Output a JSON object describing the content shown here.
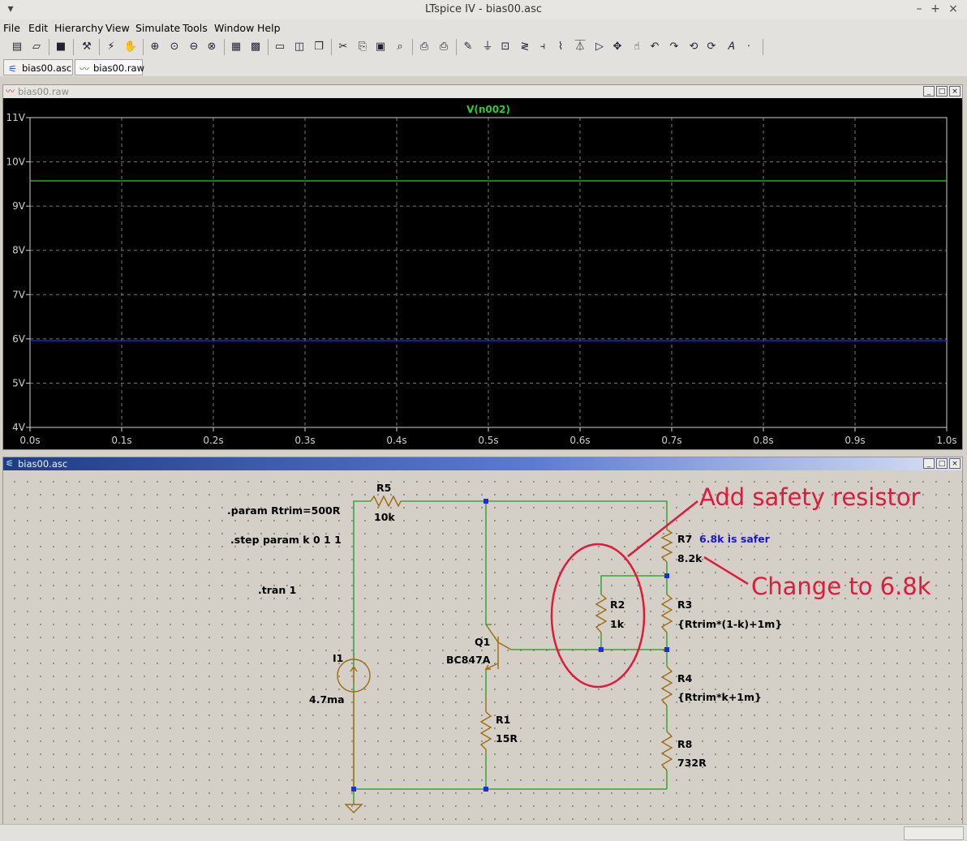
{
  "app": {
    "window_title": "LTspice IV - bias00.asc",
    "menu": [
      "File",
      "Edit",
      "Hierarchy",
      "View",
      "Simulate",
      "Tools",
      "Window",
      "Help"
    ],
    "tabs": [
      "bias00.asc",
      "bias00.raw"
    ]
  },
  "waveform_window": {
    "title": "bias00.raw",
    "trace_label": "V(n002)",
    "colors": {
      "background": "#000000",
      "trace_green": "#2ecc2e",
      "trace_blue": "#2233ee",
      "grid": "#7a7a7a",
      "axis_text": "#d0d0d0"
    }
  },
  "chart_data": {
    "type": "line",
    "title": "V(n002)",
    "xlabel": "",
    "ylabel": "",
    "xlim": [
      0.0,
      1.0
    ],
    "ylim": [
      4,
      11
    ],
    "x_ticks": [
      "0.0s",
      "0.1s",
      "0.2s",
      "0.3s",
      "0.4s",
      "0.5s",
      "0.6s",
      "0.7s",
      "0.8s",
      "0.9s",
      "1.0s"
    ],
    "y_ticks": [
      "11V",
      "10V",
      "9V",
      "8V",
      "7V",
      "6V",
      "5V",
      "4V"
    ],
    "grid": true,
    "series": [
      {
        "color": "#2ecc2e",
        "x": [
          0.0,
          1.0
        ],
        "y": [
          9.57,
          9.57
        ]
      },
      {
        "color": "#2233ee",
        "x": [
          0.0,
          1.0
        ],
        "y": [
          5.96,
          5.96
        ]
      }
    ]
  },
  "schematic_window": {
    "title": "bias00.asc",
    "directives": [
      ".param Rtrim=500R",
      ".step param k 0 1 1",
      ".tran 1"
    ],
    "components": {
      "R5": {
        "name": "R5",
        "value": "10k"
      },
      "R7": {
        "name": "R7",
        "value": "8.2k",
        "note": "6.8k is safer"
      },
      "R3": {
        "name": "R3",
        "value": "{Rtrim*(1-k)+1m}"
      },
      "R2": {
        "name": "R2",
        "value": "1k"
      },
      "Q1": {
        "name": "Q1",
        "value": "BC847A"
      },
      "I1": {
        "name": "I1",
        "value": "4.7ma"
      },
      "R4": {
        "name": "R4",
        "value": "{Rtrim*k+1m}"
      },
      "R1": {
        "name": "R1",
        "value": "15R"
      },
      "R8": {
        "name": "R8",
        "value": "732R"
      }
    },
    "annotations": {
      "add_resistor": "Add safety resistor",
      "change_value": "Change to 6.8k"
    },
    "colors": {
      "wire": "#1f9a1f",
      "component": "#a06a10",
      "node": "#1a2fd6",
      "annotation": "#e01a3a"
    }
  }
}
